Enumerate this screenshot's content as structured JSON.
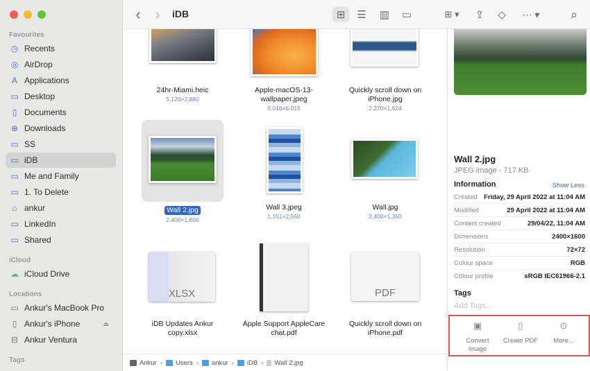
{
  "window": {
    "title": "iDB"
  },
  "colors": {
    "close": "#ee5f57",
    "minimize": "#f5bd2e",
    "zoom": "#5fc73f",
    "accent": "#2f63d2",
    "highlight_box": "#d9534f"
  },
  "sidebar": {
    "sections": [
      {
        "title": "Favourites",
        "items": [
          {
            "label": "Recents",
            "icon": "clock-icon"
          },
          {
            "label": "AirDrop",
            "icon": "airdrop-icon"
          },
          {
            "label": "Applications",
            "icon": "applications-icon"
          },
          {
            "label": "Desktop",
            "icon": "desktop-icon"
          },
          {
            "label": "Documents",
            "icon": "document-icon"
          },
          {
            "label": "Downloads",
            "icon": "download-icon"
          },
          {
            "label": "SS",
            "icon": "folder-icon"
          },
          {
            "label": "iDB",
            "icon": "folder-icon",
            "selected": true
          },
          {
            "label": "Me and Family",
            "icon": "folder-icon"
          },
          {
            "label": "1. To Delete",
            "icon": "folder-icon"
          },
          {
            "label": "ankur",
            "icon": "home-icon"
          },
          {
            "label": "LinkedIn",
            "icon": "folder-icon"
          },
          {
            "label": "Shared",
            "icon": "folder-icon"
          }
        ]
      },
      {
        "title": "iCloud",
        "items": [
          {
            "label": "iCloud Drive",
            "icon": "cloud-icon"
          }
        ]
      },
      {
        "title": "Locations",
        "items": [
          {
            "label": "Ankur's MacBook Pro",
            "icon": "laptop-icon"
          },
          {
            "label": "Ankur's iPhone",
            "icon": "iphone-icon",
            "eject": true
          },
          {
            "label": "Ankur Ventura",
            "icon": "drive-icon"
          }
        ]
      },
      {
        "title": "Tags",
        "items": []
      }
    ]
  },
  "toolbar": {
    "back": "‹",
    "forward": "›",
    "view_icons": "⊞",
    "view_list": "☰",
    "view_columns": "▥",
    "view_gallery": "▭",
    "group": "⊞ ▾",
    "share": "⇪",
    "tag": "◇",
    "more": "⋯ ▾",
    "search": "⌕"
  },
  "files": [
    {
      "name": "24hr-Miami.heic",
      "dims": "5,120×2,880"
    },
    {
      "name": "Apple-macOS-13-wallpaper.jpeg",
      "name_lines": [
        "Apple-macOS-13-",
        "wallpaper.jpeg"
      ],
      "dims": "6,016×6,016"
    },
    {
      "name": "Quickly scroll down on iPhone.jpg",
      "name_lines": [
        "Quickly scroll down on",
        "iPhone.jpg"
      ],
      "dims": "2,270×1,624"
    },
    {
      "name": "Wall 2.jpg",
      "dims": "2,400×1,600",
      "selected": true
    },
    {
      "name": "Wall 3.jpeg",
      "dims": "1,151×2,560"
    },
    {
      "name": "Wall.jpg",
      "dims": "2,400×1,350"
    },
    {
      "name": "iDB Updates Ankur copy.xlsx",
      "name_lines": [
        "iDB Updates Ankur",
        "copy.xlsx"
      ],
      "badge": "XLSX"
    },
    {
      "name": "Apple Support AppleCare chat.pdf",
      "name_lines": [
        "Apple Support AppleCare",
        "chat.pdf"
      ]
    },
    {
      "name": "Quickly scroll down on iPhone.pdf",
      "name_lines": [
        "Quickly scroll down on",
        "iPhone.pdf"
      ],
      "badge": "PDF"
    }
  ],
  "preview": {
    "title": "Wall 2.jpg",
    "subtitle": "JPEG image - 717 KB",
    "info_heading": "Information",
    "show_less": "Show Less",
    "rows": [
      {
        "key": "Created",
        "value": "Friday, 29 April 2022 at 11:04 AM"
      },
      {
        "key": "Modified",
        "value": "29 April 2022 at 11:04 AM"
      },
      {
        "key": "Content created",
        "value": "29/04/22, 11:04 AM"
      },
      {
        "key": "Dimensions",
        "value": "2400×1600"
      },
      {
        "key": "Resolution",
        "value": "72×72"
      },
      {
        "key": "Colour space",
        "value": "RGB"
      },
      {
        "key": "Colour profile",
        "value": "sRGB IEC61966-2.1"
      }
    ],
    "tags_heading": "Tags",
    "add_tags_placeholder": "Add Tags...",
    "actions": [
      {
        "label": "Convert Image",
        "lines": [
          "Convert",
          "Image"
        ],
        "icon": "convert-image-icon"
      },
      {
        "label": "Create PDF",
        "lines": [
          "Create PDF"
        ],
        "icon": "create-pdf-icon"
      },
      {
        "label": "More...",
        "lines": [
          "More..."
        ],
        "icon": "more-icon"
      }
    ]
  },
  "path": [
    {
      "label": "Ankur",
      "icon": "macbook-icon"
    },
    {
      "label": "Users",
      "icon": "folder-icon"
    },
    {
      "label": "ankur",
      "icon": "home-folder-icon"
    },
    {
      "label": "iDB",
      "icon": "folder-icon"
    },
    {
      "label": "Wall 2.jpg",
      "icon": "image-file-icon"
    }
  ]
}
